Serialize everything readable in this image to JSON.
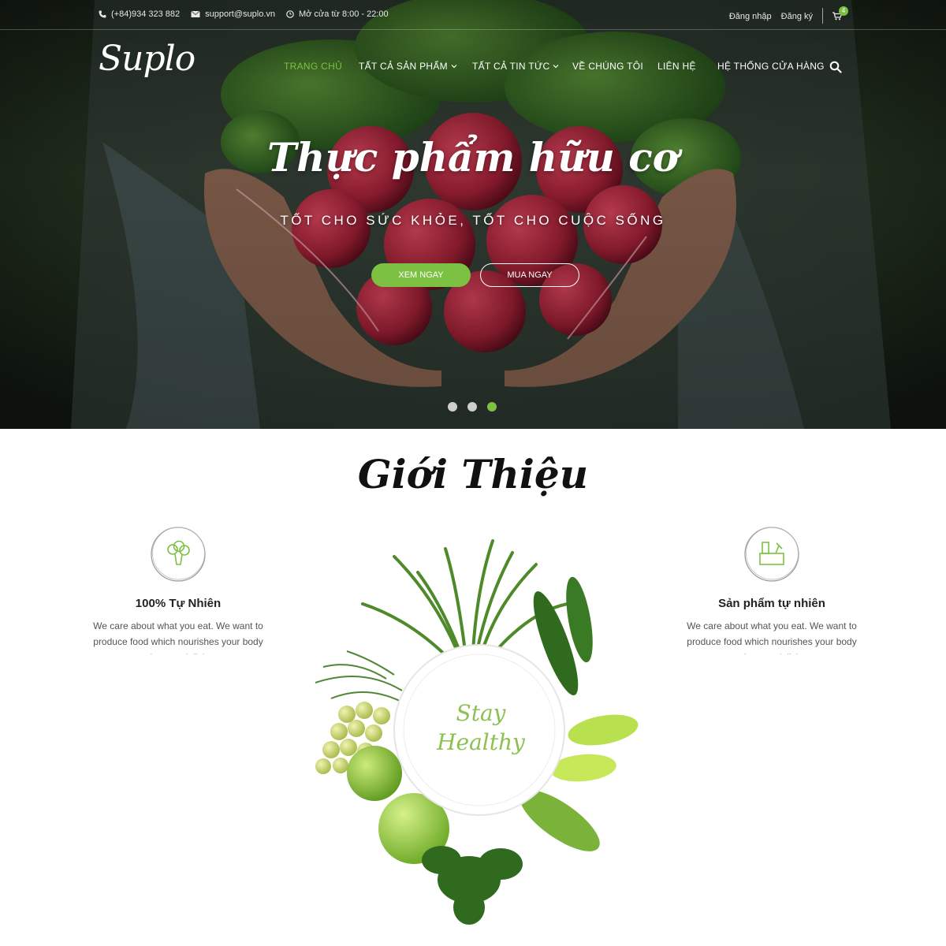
{
  "topbar": {
    "phone": "(+84)934 323 882",
    "email": "support@suplo.vn",
    "hours": "Mở cửa từ 8:00 - 22:00",
    "login": "Đăng nhập",
    "register": "Đăng ký",
    "cart_count": "4"
  },
  "brand": {
    "logo": "Suplo"
  },
  "menu": [
    {
      "label": "Trang chủ",
      "active": true
    },
    {
      "label": "Tất cả sản phẩm"
    },
    {
      "label": "Tất cả tin tức"
    },
    {
      "label": "Về chúng tôi"
    },
    {
      "label": "Liên hệ"
    },
    {
      "label": "Hệ thống cửa hàng"
    }
  ],
  "hero": {
    "title": "Thực phẩm hữu cơ",
    "subtitle": "Tốt cho sức khỏe, tốt cho cuộc sống",
    "btn_primary": "Xem ngay",
    "btn_secondary": "Mua ngay",
    "slides": 3,
    "active_slide": 3
  },
  "intro": {
    "title": "Giới Thiệu",
    "features": [
      {
        "title": "100% Tự Nhiên",
        "text": "We care about what you eat. We want to produce food which nourishes your body and tastes delicious",
        "icon": "broccoli-icon"
      },
      {
        "title": "Sản phẩm tự nhiên",
        "text": "We care about what you eat. We want to produce food which nourishes your body and tastes delicious",
        "icon": "produce-box-icon"
      }
    ],
    "plate_text_1": "Stay",
    "plate_text_2": "Healthy"
  },
  "colors": {
    "accent": "#7cc142"
  }
}
